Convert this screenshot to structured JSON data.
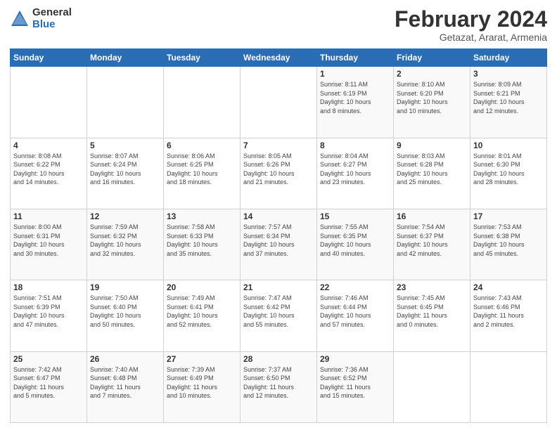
{
  "header": {
    "logo_general": "General",
    "logo_blue": "Blue",
    "month_title": "February 2024",
    "subtitle": "Getazat, Ararat, Armenia"
  },
  "weekdays": [
    "Sunday",
    "Monday",
    "Tuesday",
    "Wednesday",
    "Thursday",
    "Friday",
    "Saturday"
  ],
  "weeks": [
    [
      {
        "day": "",
        "info": ""
      },
      {
        "day": "",
        "info": ""
      },
      {
        "day": "",
        "info": ""
      },
      {
        "day": "",
        "info": ""
      },
      {
        "day": "1",
        "info": "Sunrise: 8:11 AM\nSunset: 6:19 PM\nDaylight: 10 hours\nand 8 minutes."
      },
      {
        "day": "2",
        "info": "Sunrise: 8:10 AM\nSunset: 6:20 PM\nDaylight: 10 hours\nand 10 minutes."
      },
      {
        "day": "3",
        "info": "Sunrise: 8:09 AM\nSunset: 6:21 PM\nDaylight: 10 hours\nand 12 minutes."
      }
    ],
    [
      {
        "day": "4",
        "info": "Sunrise: 8:08 AM\nSunset: 6:22 PM\nDaylight: 10 hours\nand 14 minutes."
      },
      {
        "day": "5",
        "info": "Sunrise: 8:07 AM\nSunset: 6:24 PM\nDaylight: 10 hours\nand 16 minutes."
      },
      {
        "day": "6",
        "info": "Sunrise: 8:06 AM\nSunset: 6:25 PM\nDaylight: 10 hours\nand 18 minutes."
      },
      {
        "day": "7",
        "info": "Sunrise: 8:05 AM\nSunset: 6:26 PM\nDaylight: 10 hours\nand 21 minutes."
      },
      {
        "day": "8",
        "info": "Sunrise: 8:04 AM\nSunset: 6:27 PM\nDaylight: 10 hours\nand 23 minutes."
      },
      {
        "day": "9",
        "info": "Sunrise: 8:03 AM\nSunset: 6:28 PM\nDaylight: 10 hours\nand 25 minutes."
      },
      {
        "day": "10",
        "info": "Sunrise: 8:01 AM\nSunset: 6:30 PM\nDaylight: 10 hours\nand 28 minutes."
      }
    ],
    [
      {
        "day": "11",
        "info": "Sunrise: 8:00 AM\nSunset: 6:31 PM\nDaylight: 10 hours\nand 30 minutes."
      },
      {
        "day": "12",
        "info": "Sunrise: 7:59 AM\nSunset: 6:32 PM\nDaylight: 10 hours\nand 32 minutes."
      },
      {
        "day": "13",
        "info": "Sunrise: 7:58 AM\nSunset: 6:33 PM\nDaylight: 10 hours\nand 35 minutes."
      },
      {
        "day": "14",
        "info": "Sunrise: 7:57 AM\nSunset: 6:34 PM\nDaylight: 10 hours\nand 37 minutes."
      },
      {
        "day": "15",
        "info": "Sunrise: 7:55 AM\nSunset: 6:35 PM\nDaylight: 10 hours\nand 40 minutes."
      },
      {
        "day": "16",
        "info": "Sunrise: 7:54 AM\nSunset: 6:37 PM\nDaylight: 10 hours\nand 42 minutes."
      },
      {
        "day": "17",
        "info": "Sunrise: 7:53 AM\nSunset: 6:38 PM\nDaylight: 10 hours\nand 45 minutes."
      }
    ],
    [
      {
        "day": "18",
        "info": "Sunrise: 7:51 AM\nSunset: 6:39 PM\nDaylight: 10 hours\nand 47 minutes."
      },
      {
        "day": "19",
        "info": "Sunrise: 7:50 AM\nSunset: 6:40 PM\nDaylight: 10 hours\nand 50 minutes."
      },
      {
        "day": "20",
        "info": "Sunrise: 7:49 AM\nSunset: 6:41 PM\nDaylight: 10 hours\nand 52 minutes."
      },
      {
        "day": "21",
        "info": "Sunrise: 7:47 AM\nSunset: 6:42 PM\nDaylight: 10 hours\nand 55 minutes."
      },
      {
        "day": "22",
        "info": "Sunrise: 7:46 AM\nSunset: 6:44 PM\nDaylight: 10 hours\nand 57 minutes."
      },
      {
        "day": "23",
        "info": "Sunrise: 7:45 AM\nSunset: 6:45 PM\nDaylight: 11 hours\nand 0 minutes."
      },
      {
        "day": "24",
        "info": "Sunrise: 7:43 AM\nSunset: 6:46 PM\nDaylight: 11 hours\nand 2 minutes."
      }
    ],
    [
      {
        "day": "25",
        "info": "Sunrise: 7:42 AM\nSunset: 6:47 PM\nDaylight: 11 hours\nand 5 minutes."
      },
      {
        "day": "26",
        "info": "Sunrise: 7:40 AM\nSunset: 6:48 PM\nDaylight: 11 hours\nand 7 minutes."
      },
      {
        "day": "27",
        "info": "Sunrise: 7:39 AM\nSunset: 6:49 PM\nDaylight: 11 hours\nand 10 minutes."
      },
      {
        "day": "28",
        "info": "Sunrise: 7:37 AM\nSunset: 6:50 PM\nDaylight: 11 hours\nand 12 minutes."
      },
      {
        "day": "29",
        "info": "Sunrise: 7:36 AM\nSunset: 6:52 PM\nDaylight: 11 hours\nand 15 minutes."
      },
      {
        "day": "",
        "info": ""
      },
      {
        "day": "",
        "info": ""
      }
    ]
  ]
}
